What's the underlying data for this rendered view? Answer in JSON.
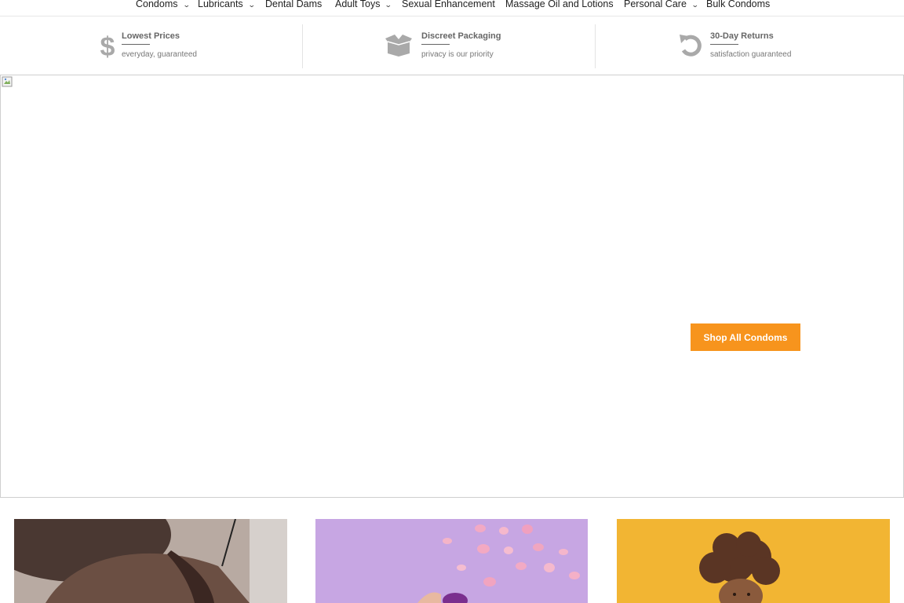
{
  "nav": {
    "items": [
      {
        "label": "Condoms",
        "has_dropdown": true
      },
      {
        "label": "Lubricants",
        "has_dropdown": true
      },
      {
        "label": "Dental Dams",
        "has_dropdown": false
      },
      {
        "label": "Adult Toys",
        "has_dropdown": true
      },
      {
        "label": "Sexual Enhancement",
        "has_dropdown": false
      },
      {
        "label": "Massage Oil and Lotions",
        "has_dropdown": false
      },
      {
        "label": "Personal Care",
        "has_dropdown": true
      },
      {
        "label": "Bulk Condoms",
        "has_dropdown": false
      }
    ],
    "chevron": "⌄"
  },
  "benefits": [
    {
      "icon": "dollar-icon",
      "title": "Lowest Prices",
      "subtitle": "everyday, guaranteed"
    },
    {
      "icon": "box-icon",
      "title": "Discreet Packaging",
      "subtitle": "privacy is our priority"
    },
    {
      "icon": "undo-icon",
      "title": "30-Day Returns",
      "subtitle": "satisfaction guaranteed"
    }
  ],
  "hero": {
    "cta_label": "Shop All Condoms",
    "cta_color": "#f7941d"
  },
  "tiles": [
    {
      "name": "lingerie-photo"
    },
    {
      "name": "petals-photo"
    },
    {
      "name": "curly-hair-photo"
    }
  ]
}
